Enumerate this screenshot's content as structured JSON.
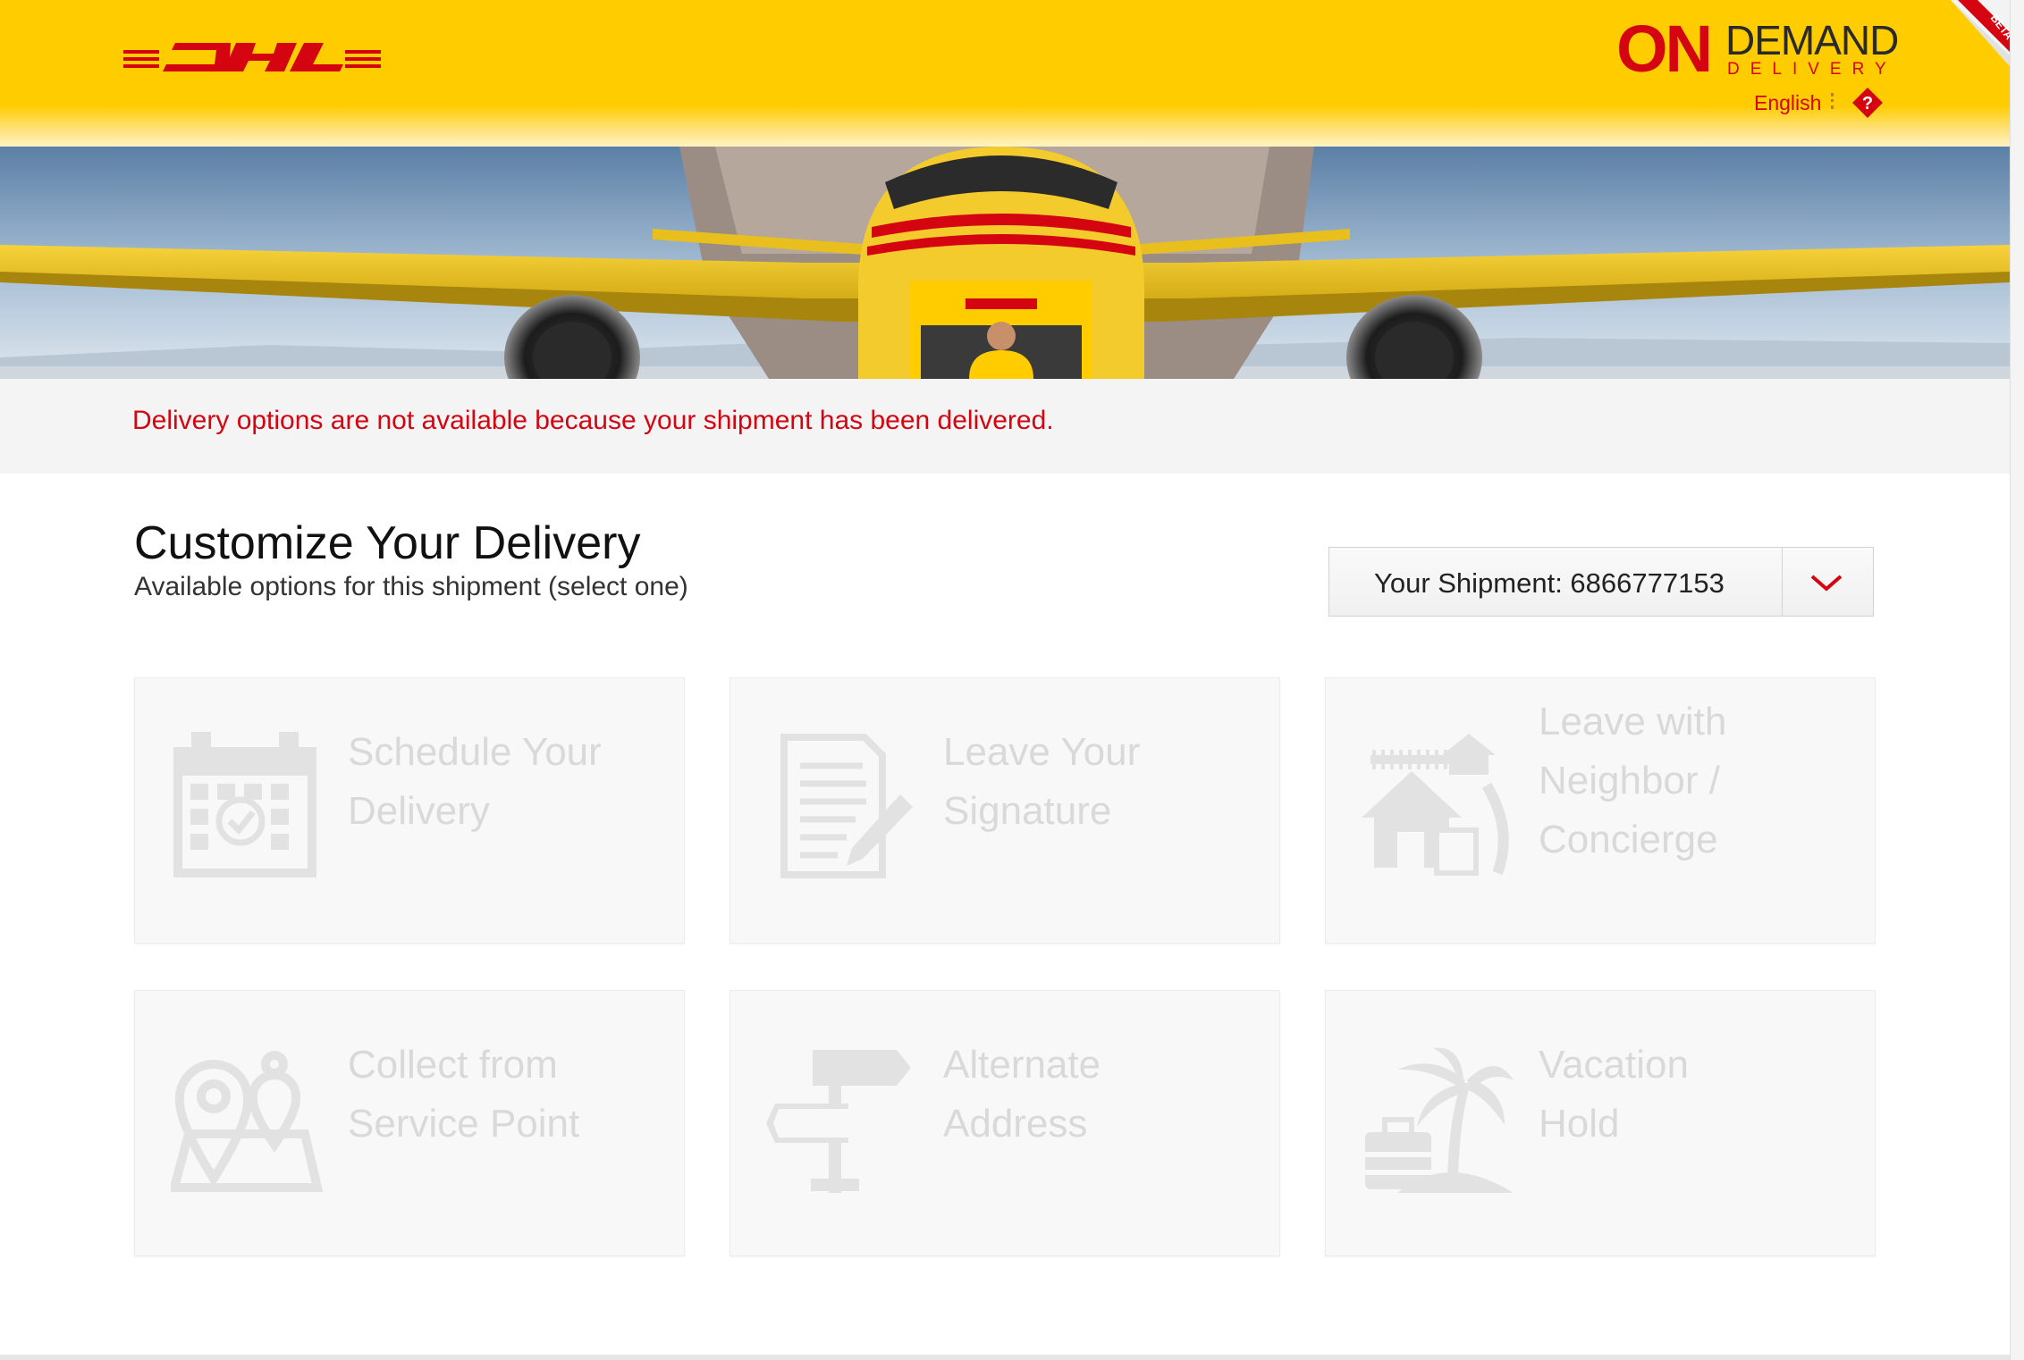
{
  "header": {
    "logo_name": "dhl-logo",
    "logo_text": "DHL",
    "brand_on": "ON",
    "brand_demand": "DEMAND",
    "brand_delivery": "DELIVERY",
    "language": "English",
    "help_symbol": "?",
    "beta_label": "BETA"
  },
  "notice": {
    "message": "Delivery options are not available because your shipment has been delivered."
  },
  "main": {
    "title": "Customize Your Delivery",
    "subtitle": "Available options for this shipment (select one)",
    "shipment_select": "Your Shipment: 6866777153"
  },
  "options": [
    {
      "label_line1": "Schedule Your",
      "label_line2": "Delivery",
      "label_line3": "",
      "icon": "calendar-icon"
    },
    {
      "label_line1": "Leave Your",
      "label_line2": "Signature",
      "label_line3": "",
      "icon": "signature-document-icon"
    },
    {
      "label_line1": "Leave with",
      "label_line2": "Neighbor /",
      "label_line3": "Concierge",
      "icon": "neighbor-house-icon"
    },
    {
      "label_line1": "Collect from",
      "label_line2": "Service Point",
      "label_line3": "",
      "icon": "map-pin-icon"
    },
    {
      "label_line1": "Alternate",
      "label_line2": "Address",
      "label_line3": "",
      "icon": "signpost-icon"
    },
    {
      "label_line1": "Vacation",
      "label_line2": "Hold",
      "label_line3": "",
      "icon": "palm-tree-suitcase-icon"
    }
  ],
  "colors": {
    "brand_yellow": "#ffcc00",
    "brand_red": "#d40511",
    "disabled_text": "#d9d9d9",
    "card_bg": "#f8f8f8"
  }
}
